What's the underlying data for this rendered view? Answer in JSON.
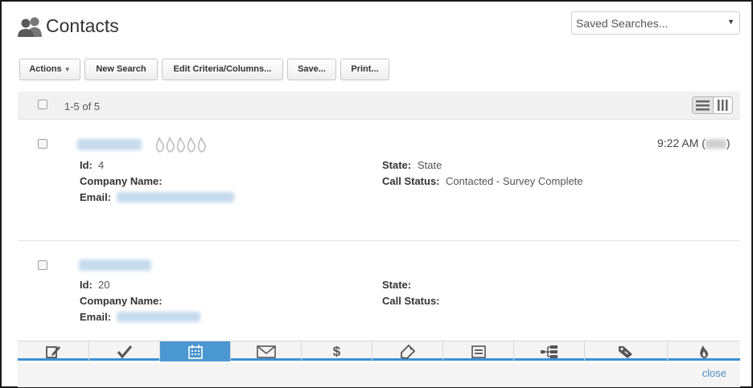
{
  "header": {
    "title": "Contacts",
    "icon": "contacts-icon",
    "saved_searches": {
      "value": "Saved Searches...",
      "icon": "caret-down-icon"
    }
  },
  "toolbar": {
    "actions_label": "Actions",
    "new_search_label": "New Search",
    "edit_criteria_label": "Edit Criteria/Columns...",
    "save_label": "Save...",
    "print_label": "Print..."
  },
  "list": {
    "count_text": "1-5 of 5",
    "view_toggle_icons": [
      "list-view-icon",
      "column-view-icon"
    ]
  },
  "records": [
    {
      "time": "9:22 AM (",
      "time_suffix": ")",
      "fields": {
        "id_label": "Id:",
        "id_value": "4",
        "company_label": "Company Name:",
        "company_value": "",
        "email_label": "Email:",
        "state_label": "State:",
        "state_value": "State",
        "call_status_label": "Call Status:",
        "call_status_value": "Contacted - Survey Complete"
      },
      "score_icon": "flame-score-icon"
    },
    {
      "fields": {
        "id_label": "Id:",
        "id_value": "20",
        "company_label": "Company Name:",
        "company_value": "",
        "email_label": "Email:",
        "state_label": "State:",
        "state_value": "",
        "call_status_label": "Call Status:",
        "call_status_value": ""
      }
    }
  ],
  "tabs": [
    {
      "icon": "note-icon"
    },
    {
      "icon": "check-icon"
    },
    {
      "icon": "calendar-icon",
      "active": true
    },
    {
      "icon": "email-icon"
    },
    {
      "icon": "dollar-icon",
      "glyph": "$"
    },
    {
      "icon": "tag-icon"
    },
    {
      "icon": "form-icon"
    },
    {
      "icon": "sequence-icon"
    },
    {
      "icon": "price-tag-icon"
    },
    {
      "icon": "flame-icon"
    }
  ],
  "panel": {
    "close_label": "close"
  },
  "colors": {
    "accent": "#4b97d1",
    "link": "#4a8fc9"
  }
}
